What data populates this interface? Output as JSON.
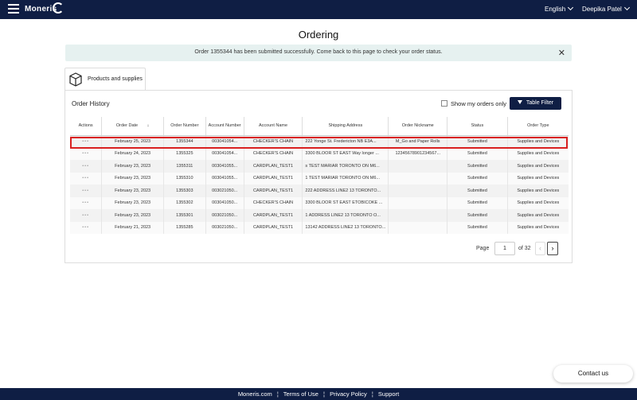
{
  "header": {
    "logo": "Moneris",
    "language": "English",
    "user": "Deepika Patel"
  },
  "page": {
    "title": "Ordering",
    "alert": "Order 1355344 has been submitted successfully. Come back to this page to check your order status.",
    "alert_close": "✕"
  },
  "tab": {
    "label": "Products and supplies",
    "icon": "box-icon"
  },
  "panel": {
    "title": "Order History",
    "my_orders_label": "Show my orders only",
    "filter_label": "Table Filter"
  },
  "table": {
    "headers": [
      "Actions",
      "Order Date",
      "Order Number",
      "Account Number",
      "Account Name",
      "Shipping Address",
      "Order Nickname",
      "Status",
      "Order Type"
    ],
    "sort_indicator": "↓",
    "rows": [
      [
        "•••",
        "February 25, 2023",
        "1355344",
        "003041054...",
        "CHECKER'S CHAIN",
        "222 Yonge St. Fredericton NB E3A...",
        "M_Go and Paper Rolls",
        "Submitted",
        "Supplies and Devices"
      ],
      [
        "•••",
        "February 24, 2023",
        "1355325",
        "003041054...",
        "CHECKER'S CHAIN",
        "3300 BLOOR ST EAST Way longer ...",
        "12345678901234567...",
        "Submitted",
        "Supplies and Devices"
      ],
      [
        "•••",
        "February 23, 2023",
        "1355311",
        "003041055...",
        "CARDPLAN_TEST1",
        "s TEST MARIAR TORONTO ON M6...",
        "",
        "Submitted",
        "Supplies and Devices"
      ],
      [
        "•••",
        "February 23, 2023",
        "1355310",
        "003041055...",
        "CARDPLAN_TEST1",
        "1 TEST MARIAR TORONTO ON M6...",
        "",
        "Submitted",
        "Supplies and Devices"
      ],
      [
        "•••",
        "February 23, 2023",
        "1355303",
        "003021050...",
        "CARDPLAN_TEST1",
        "222 ADDRESS LINE2 13 TORONTO...",
        "",
        "Submitted",
        "Supplies and Devices"
      ],
      [
        "•••",
        "February 23, 2023",
        "1355302",
        "003041050...",
        "CHECKER'S CHAIN",
        "3300 BLOOR ST EAST ETOBICOKE ...",
        "",
        "Submitted",
        "Supplies and Devices"
      ],
      [
        "•••",
        "February 23, 2023",
        "1355301",
        "003021050...",
        "CARDPLAN_TEST1",
        "1 ADDRESS LINE2 13 TORONTO O...",
        "",
        "Submitted",
        "Supplies and Devices"
      ],
      [
        "•••",
        "February 21, 2023",
        "1355285",
        "003021050...",
        "CARDPLAN_TEST1",
        "13142 ADDRESS LINE2 13 TORONTO...",
        "",
        "Submitted",
        "Supplies and Devices"
      ]
    ]
  },
  "pager": {
    "label": "Page",
    "current": "1",
    "of": "of 32",
    "prev": "‹",
    "next": "›"
  },
  "contact": "Contact us",
  "footer": {
    "links": [
      "Moneris.com",
      "Terms of Use",
      "Privacy Policy",
      "Support"
    ],
    "separator": "¦"
  }
}
